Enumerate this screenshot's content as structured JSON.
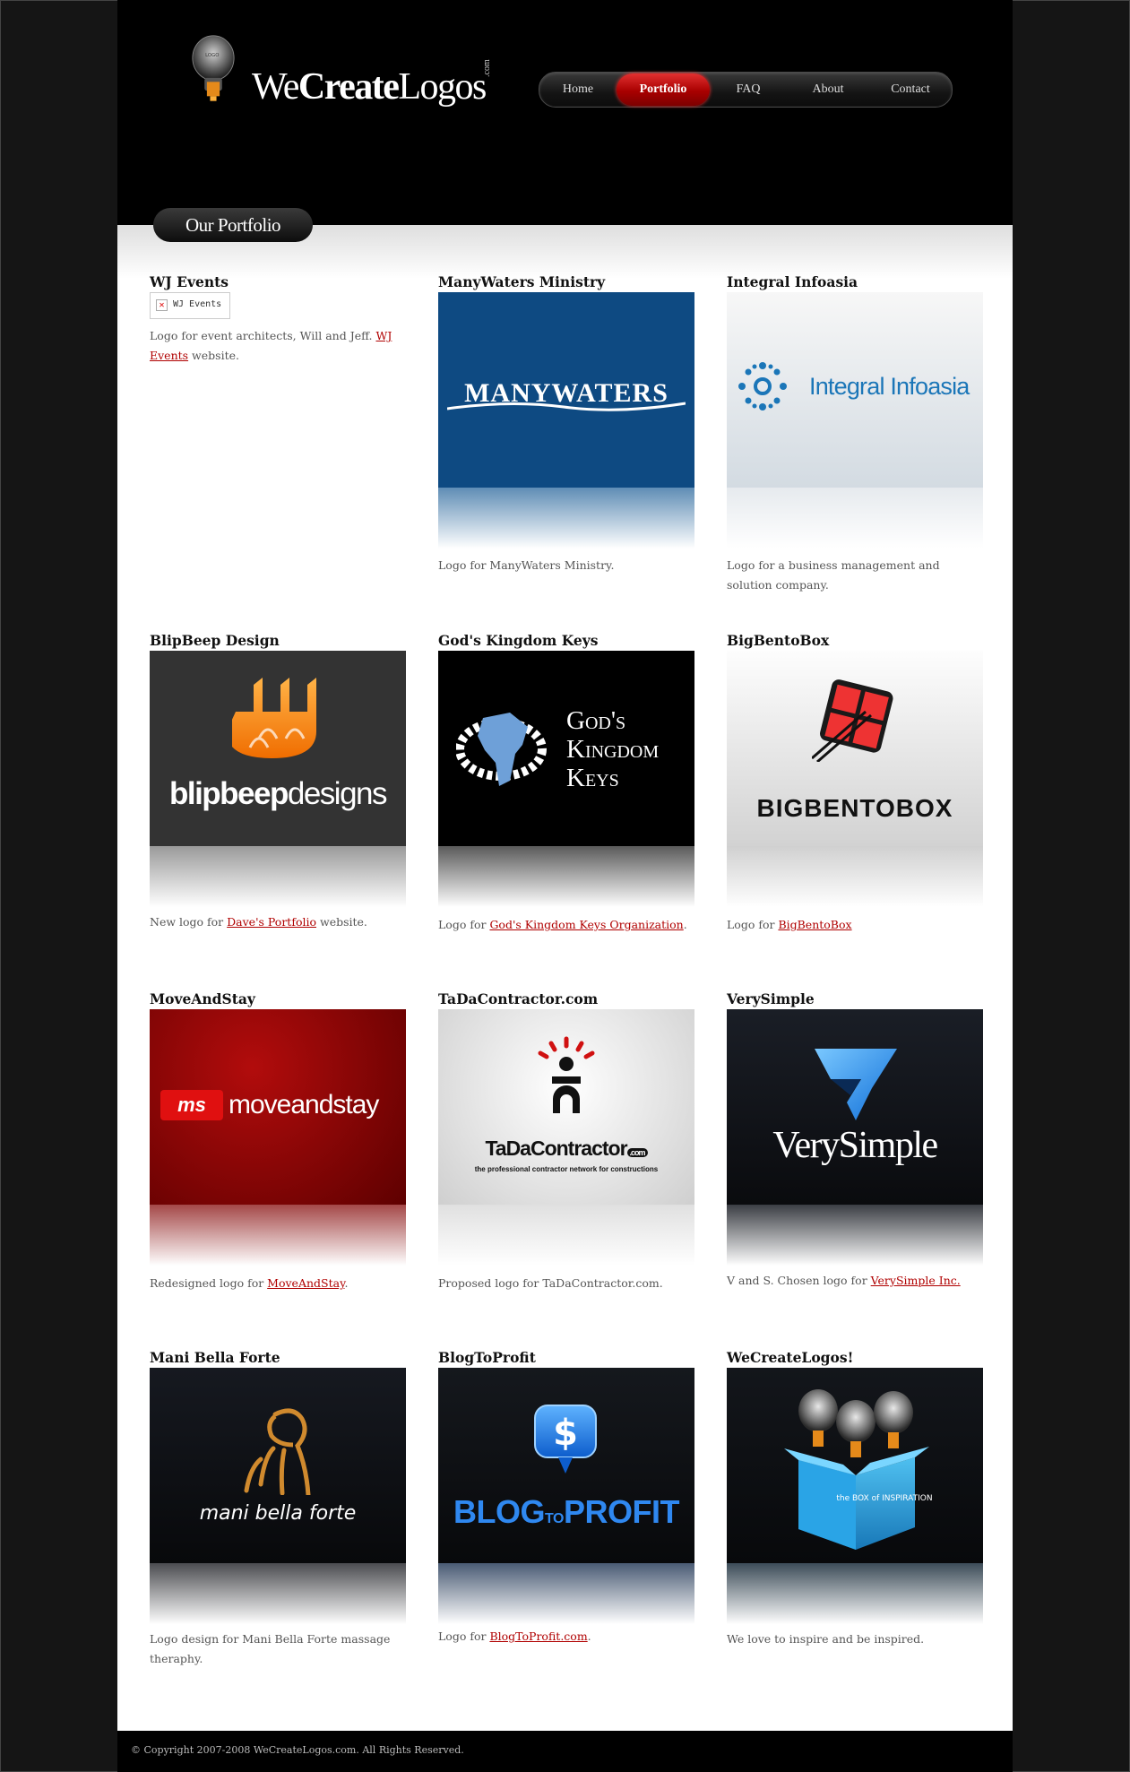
{
  "site": {
    "logo_we": "We",
    "logo_create": "Create",
    "logo_logos": "Logos",
    "logo_dotcom": ".com"
  },
  "nav": {
    "items": [
      {
        "label": "Home"
      },
      {
        "label": "Portfolio"
      },
      {
        "label": "FAQ"
      },
      {
        "label": "About"
      },
      {
        "label": "Contact"
      }
    ],
    "active": "Portfolio"
  },
  "section": {
    "title": "Our Portfolio"
  },
  "portfolio": [
    {
      "title": "WJ Events",
      "broken_alt": "WJ Events",
      "desc_before": "Logo for event architects, Will and Jeff. ",
      "link": "WJ Events",
      "desc_after": " website."
    },
    {
      "title": "ManyWaters Ministry",
      "logo_text": "MANYWATERS",
      "desc_before": "Logo for ManyWaters Ministry.",
      "link": "",
      "desc_after": ""
    },
    {
      "title": "Integral Infoasia",
      "logo_text": "Integral Infoasia",
      "desc_before": "Logo for a business management and solution company.",
      "link": "",
      "desc_after": ""
    },
    {
      "title": "BlipBeep Design",
      "logo_text_a": "blipbeep",
      "logo_text_b": "designs",
      "logo_mark": "bbd",
      "desc_before": "New logo for ",
      "link": "Dave's Portfolio",
      "desc_after": " website."
    },
    {
      "title": "God's Kingdom Keys",
      "logo_line1": "God's",
      "logo_line2": "Kingdom",
      "logo_line3": "Keys",
      "desc_before": "Logo for ",
      "link": "God's Kingdom Keys Organization",
      "desc_after": "."
    },
    {
      "title": "BigBentoBox",
      "logo_text": "BIGBENTOBOX",
      "desc_before": "Logo for ",
      "link": "BigBentoBox",
      "desc_after": ""
    },
    {
      "title": "MoveAndStay",
      "logo_text": "moveandstay",
      "logo_mark": "ms",
      "desc_before": "Redesigned logo for ",
      "link": "MoveAndStay",
      "desc_after": "."
    },
    {
      "title": "TaDaContractor.com",
      "logo_text": "TaDaContractor",
      "logo_dotcom": ".com",
      "logo_tag": "the professional contractor network for constructions",
      "desc_before": "Proposed logo for TaDaContractor.com.",
      "link": "",
      "desc_after": ""
    },
    {
      "title": "VerySimple",
      "logo_text": "VerySimple",
      "desc_before": "V and S. Chosen logo for ",
      "link": "VerySimple Inc.",
      "desc_after": ""
    },
    {
      "title": "Mani Bella Forte",
      "logo_text": "mani bella forte",
      "desc_before": "Logo design for Mani Bella Forte massage theraphy.",
      "link": "",
      "desc_after": ""
    },
    {
      "title": "BlogToProfit",
      "logo_a": "BLOG",
      "logo_b": "TO",
      "logo_c": "PROFIT",
      "desc_before": "Logo for ",
      "link": "BlogToProfit.com",
      "desc_after": "."
    },
    {
      "title": "WeCreateLogos!",
      "logo_box": "the BOX of INSPIRATION",
      "desc_before": "We love to inspire and be inspired.",
      "link": "",
      "desc_after": ""
    }
  ],
  "footer": {
    "copyright": "© Copyright 2007-2008 WeCreateLogos.com. All Rights Reserved."
  },
  "colors": {
    "accent": "#b00000",
    "nav_active": "#c00000",
    "background": "#151515"
  }
}
